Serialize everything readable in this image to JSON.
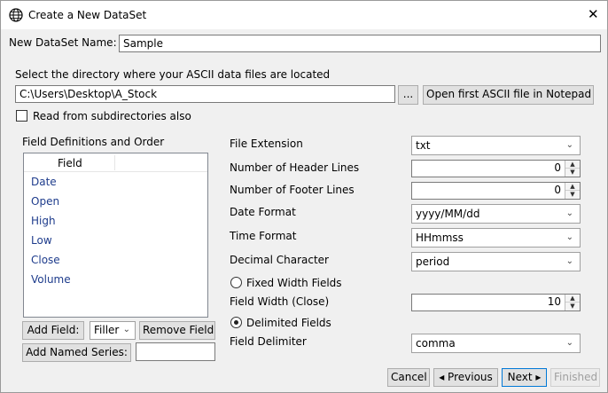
{
  "window": {
    "title": "Create a New DataSet",
    "close_glyph": "✕"
  },
  "dataset_name": {
    "label": "New DataSet Name:",
    "value": "Sample"
  },
  "directory": {
    "label": "Select the directory where your ASCII data files are located",
    "path": "C:\\Users\\Desktop\\A_Stock",
    "browse_label": "...",
    "open_notepad_label": "Open first ASCII file in Notepad",
    "subdirs_label": "Read from subdirectories also",
    "subdirs_checked": false
  },
  "fields": {
    "label": "Field Definitions and Order",
    "column_header": "Field",
    "items": [
      "Date",
      "Open",
      "High",
      "Low",
      "Close",
      "Volume"
    ],
    "add_field_label": "Add Field:",
    "filler_label": "Filler",
    "remove_field_label": "Remove Field",
    "add_named_series_label": "Add Named Series:",
    "named_series_value": ""
  },
  "settings": {
    "file_extension": {
      "label": "File Extension",
      "value": "txt"
    },
    "header_lines": {
      "label": "Number of Header Lines",
      "value": "0"
    },
    "footer_lines": {
      "label": "Number of Footer Lines",
      "value": "0"
    },
    "date_format": {
      "label": "Date Format",
      "value": "yyyy/MM/dd"
    },
    "time_format": {
      "label": "Time Format",
      "value": "HHmmss"
    },
    "decimal_char": {
      "label": "Decimal Character",
      "value": "period"
    },
    "fixed_width": {
      "label": "Fixed Width Fields",
      "selected": false
    },
    "field_width": {
      "label": "Field Width (Close)",
      "value": "10"
    },
    "delimited": {
      "label": "Delimited Fields",
      "selected": true
    },
    "field_delimiter": {
      "label": "Field Delimiter",
      "value": "comma"
    }
  },
  "footer": {
    "cancel_label": "Cancel",
    "previous_label": "◂ Previous",
    "next_label": "Next ▸",
    "finished_label": "Finished"
  },
  "colors": {
    "accent": "#0078d7",
    "list_text": "#1e3c8c",
    "disabled_text": "#a0a0a0"
  }
}
